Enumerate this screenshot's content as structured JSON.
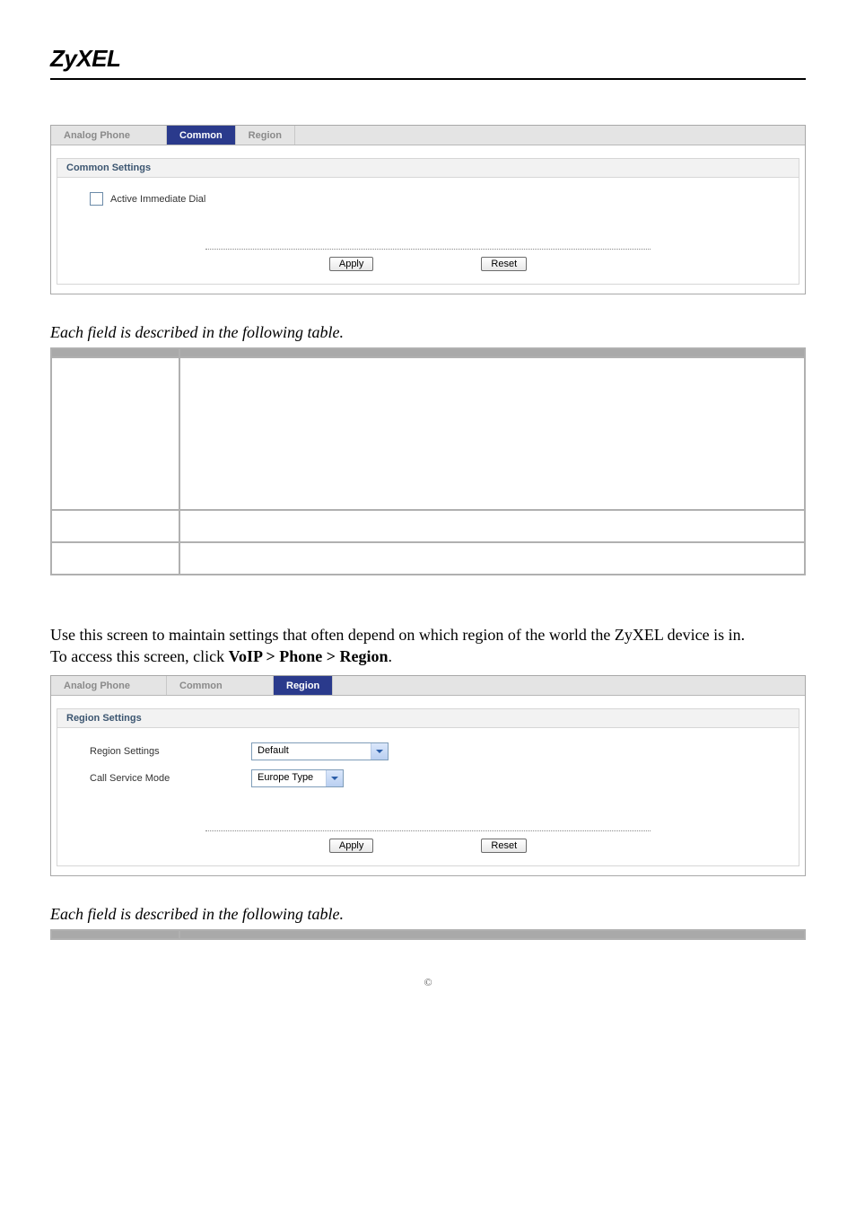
{
  "brand": "ZyXEL",
  "screenshot_common": {
    "tabs": [
      "Analog Phone",
      "Common",
      "Region"
    ],
    "active_tab_index": 1,
    "panel_title": "Common Settings",
    "checkbox_label": "Active Immediate Dial",
    "apply": "Apply",
    "reset": "Reset"
  },
  "table1_caption": "Each field is described in the following table.",
  "table1": {
    "headers": [
      "",
      ""
    ],
    "rows": [
      {
        "label": "",
        "desc": ""
      },
      {
        "label": "",
        "desc": ""
      },
      {
        "label": "",
        "desc": ""
      }
    ]
  },
  "region_intro": {
    "line1": "Use this screen to maintain settings that often depend on which region of the world the ZyXEL device is in.",
    "line2_prefix": "To access this screen, click ",
    "line2_bold": "VoIP > Phone > Region",
    "line2_suffix": "."
  },
  "screenshot_region": {
    "tabs": [
      "Analog Phone",
      "Common",
      "Region"
    ],
    "active_tab_index": 2,
    "panel_title": "Region Settings",
    "row1_label": "Region Settings",
    "row1_value": "Default",
    "row2_label": "Call Service Mode",
    "row2_value": "Europe Type",
    "apply": "Apply",
    "reset": "Reset"
  },
  "table2_caption": "Each field is described in the following table.",
  "table2": {
    "headers": [
      "",
      ""
    ]
  },
  "footer": "©"
}
